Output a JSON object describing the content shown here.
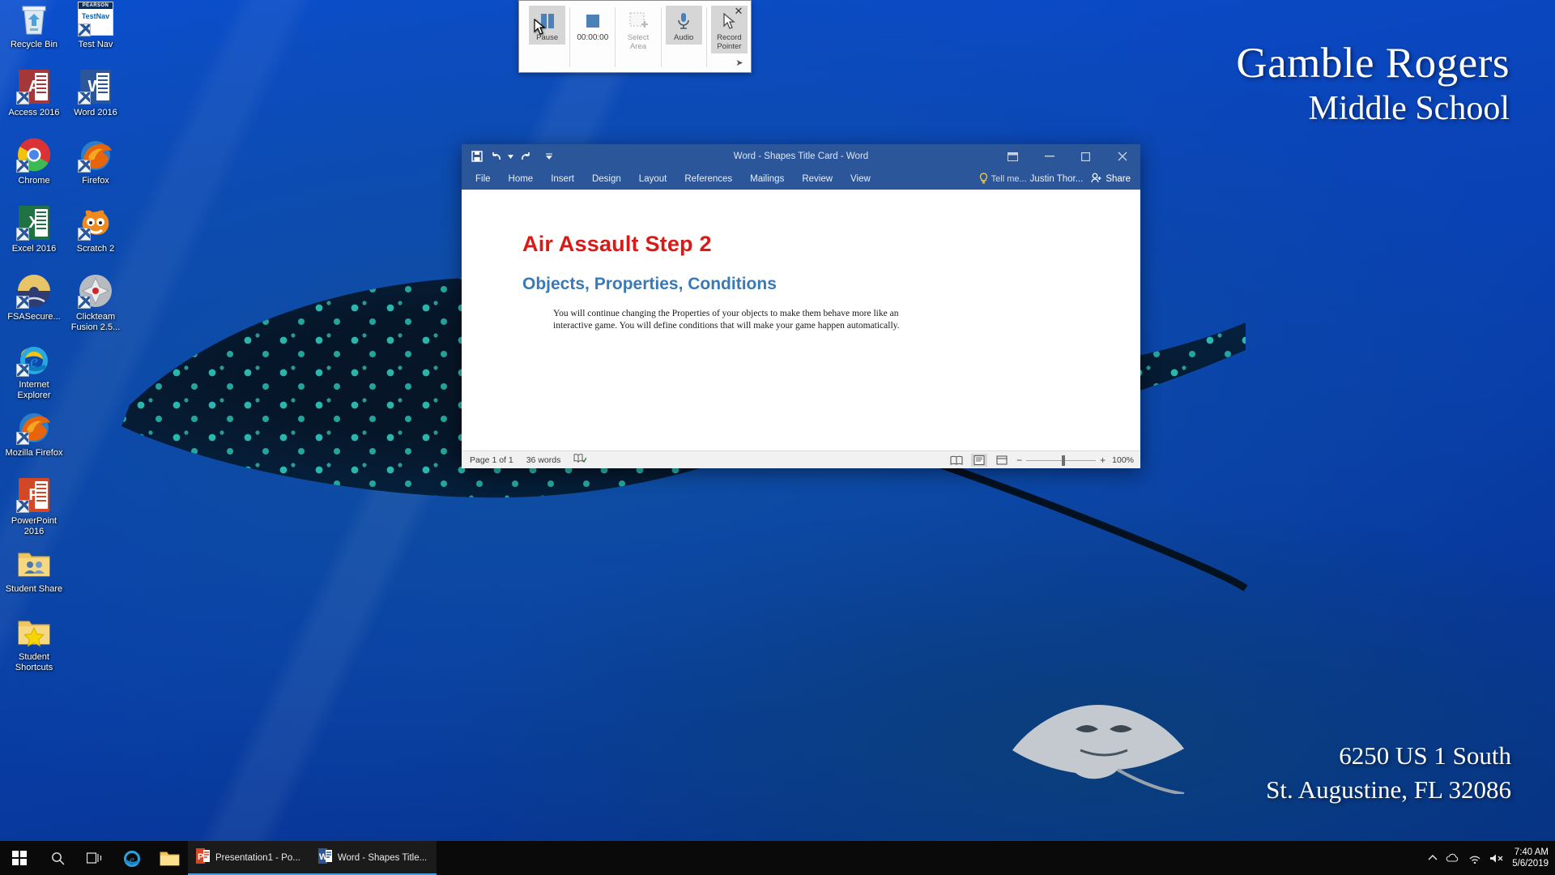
{
  "desktop": {
    "wallpaper": {
      "school_name": "Gamble Rogers",
      "school_subtitle": "Middle School",
      "address_line1": "6250 US 1 South",
      "address_line2": "St. Augustine, FL 32086",
      "bg_color": "#0a45bb"
    },
    "icons": [
      {
        "label": "Recycle Bin",
        "icon": "recycle-bin-icon",
        "shortcut": false,
        "col": 0
      },
      {
        "label": "Access 2016",
        "icon": "access-2016-icon",
        "shortcut": true,
        "col": 0,
        "color": "#a4373a",
        "letter": "A"
      },
      {
        "label": "Chrome",
        "icon": "chrome-icon",
        "shortcut": true,
        "col": 0
      },
      {
        "label": "Excel 2016",
        "icon": "excel-2016-icon",
        "shortcut": true,
        "col": 0,
        "color": "#207245",
        "letter": "X"
      },
      {
        "label": "FSASecure...",
        "icon": "fsa-secure-icon",
        "shortcut": true,
        "col": 0
      },
      {
        "label": "Internet Explorer",
        "icon": "internet-explorer-icon",
        "shortcut": true,
        "col": 0
      },
      {
        "label": "Mozilla Firefox",
        "icon": "firefox-icon",
        "shortcut": true,
        "col": 0
      },
      {
        "label": "PowerPoint 2016",
        "icon": "powerpoint-2016-icon",
        "shortcut": true,
        "col": 0,
        "color": "#d24726",
        "letter": "P"
      },
      {
        "label": "Student Share",
        "icon": "folder-users-icon",
        "shortcut": false,
        "col": 0
      },
      {
        "label": "Student Shortcuts",
        "icon": "folder-star-icon",
        "shortcut": false,
        "col": 0
      },
      {
        "label": "Test Nav",
        "icon": "testnav-icon",
        "shortcut": true,
        "col": 1,
        "brand": "PEARSON",
        "sub": "TestNav"
      },
      {
        "label": "Word 2016",
        "icon": "word-2016-icon",
        "shortcut": true,
        "col": 1,
        "color": "#2b579a",
        "letter": "W"
      },
      {
        "label": "Firefox",
        "icon": "firefox-icon",
        "shortcut": true,
        "col": 1
      },
      {
        "label": "Scratch 2",
        "icon": "scratch-2-icon",
        "shortcut": true,
        "col": 1
      },
      {
        "label": "Clickteam Fusion 2.5...",
        "icon": "clickteam-fusion-icon",
        "shortcut": true,
        "col": 1
      }
    ]
  },
  "recorder": {
    "pause_label": "Pause",
    "timer": "00:00:00",
    "select_area_label": "Select Area",
    "audio_label": "Audio",
    "record_pointer_label": "Record Pointer",
    "close_label": "✕",
    "pin_label": "➤"
  },
  "word": {
    "titlebar": {
      "title": "Word - Shapes Title Card - Word",
      "quick_access": [
        {
          "name": "save-icon",
          "glyph": "ὋE"
        },
        {
          "name": "undo-icon",
          "glyph": "↶"
        },
        {
          "name": "redo-icon",
          "glyph": "↻"
        },
        {
          "name": "customize-qat-icon",
          "glyph": "▾"
        }
      ],
      "window_controls": [
        {
          "name": "ribbon-display-options-icon",
          "glyph": "⌷"
        },
        {
          "name": "minimize-icon",
          "glyph": "—"
        },
        {
          "name": "maximize-icon",
          "glyph": "☐"
        },
        {
          "name": "close-icon",
          "glyph": "✕"
        }
      ],
      "accent_color": "#2b579a"
    },
    "ribbon": {
      "tabs": [
        "File",
        "Home",
        "Insert",
        "Design",
        "Layout",
        "References",
        "Mailings",
        "Review",
        "View"
      ],
      "tell_me": "Tell me...",
      "user": "Justin Thor...",
      "share": "Share"
    },
    "document": {
      "title": "Air Assault Step 2",
      "title_color": "#d91a17",
      "subtitle": "Objects, Properties, Conditions",
      "subtitle_color": "#3a79b8",
      "body": "You will continue changing the Properties of your objects to make them behave more like an interactive game.  You will define conditions that will make your game happen automatically."
    },
    "statusbar": {
      "page": "Page 1 of 1",
      "words": "36 words",
      "proofing_icon": "proofing-errors-icon",
      "zoom_level": "100%",
      "views": [
        "read-mode-icon",
        "print-layout-icon",
        "web-layout-icon"
      ]
    }
  },
  "taskbar": {
    "start_label": "start-button",
    "search_label": "search-icon",
    "taskview_label": "task-view-icon",
    "pinned": [
      {
        "label": "Internet Explorer",
        "icon": "internet-explorer-icon"
      },
      {
        "label": "File Explorer",
        "icon": "file-explorer-icon"
      }
    ],
    "tasks": [
      {
        "label": "Presentation1 - Po...",
        "icon": "powerpoint-icon",
        "active": true
      },
      {
        "label": "Word - Shapes Title...",
        "icon": "word-icon",
        "active": true
      }
    ],
    "tray": [
      {
        "name": "show-hidden-icons-icon",
        "glyph": "⌃"
      },
      {
        "name": "onedrive-icon",
        "glyph": "☁"
      },
      {
        "name": "network-icon",
        "glyph": "὏6"
      },
      {
        "name": "volume-mute-icon",
        "glyph": "ὐA"
      }
    ],
    "clock_time": "7:40 AM",
    "clock_date": "5/6/2019"
  }
}
